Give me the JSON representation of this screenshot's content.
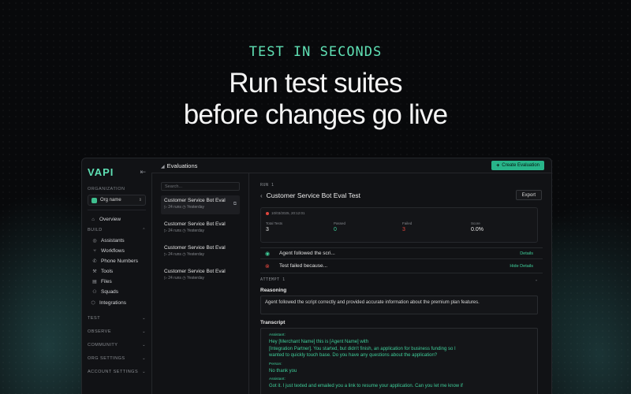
{
  "hero": {
    "eyebrow": "TEST IN SECONDS",
    "headline_line1": "Run test suites",
    "headline_line2": "before changes go live"
  },
  "colors": {
    "accent": "#5fe0b4",
    "button": "#28b58a",
    "danger": "#e0463d",
    "background": "#08090b"
  },
  "sidebar": {
    "logo": "VAPI",
    "org_label": "ORGANIZATION",
    "org_name": "Org name",
    "overview": "Overview",
    "build_label": "BUILD",
    "build_items": [
      {
        "label": "Assistants",
        "icon": "assistant-icon"
      },
      {
        "label": "Workflows",
        "icon": "workflow-icon"
      },
      {
        "label": "Phone Numbers",
        "icon": "phone-icon"
      },
      {
        "label": "Tools",
        "icon": "tool-icon"
      },
      {
        "label": "Files",
        "icon": "file-icon"
      },
      {
        "label": "Squads",
        "icon": "squad-icon"
      }
    ],
    "integrations": "Integrations",
    "groups": [
      "TEST",
      "OBSERVE",
      "COMMUNITY",
      "ORG SETTINGS",
      "ACCOUNT SETTINGS"
    ]
  },
  "topbar": {
    "title": "Evaluations",
    "create_label": "Create Evaluation"
  },
  "list": {
    "search_placeholder": "Search...",
    "items": [
      {
        "name": "Customer Service Bot Eval",
        "runs": "24 runs",
        "when": "Yesterday"
      },
      {
        "name": "Customer Service Bot Eval",
        "runs": "24 runs",
        "when": "Yesterday"
      },
      {
        "name": "Customer Service Bot Eval",
        "runs": "24 runs",
        "when": "Yesterday"
      },
      {
        "name": "Customer Service Bot Eval",
        "runs": "24 runs",
        "when": "Yesterday"
      }
    ]
  },
  "detail": {
    "run_label": "RUN 1",
    "title": "Customer Service Bot Eval Test",
    "export_label": "Export",
    "timestamp": "10/03/2025, 20:12:01",
    "stats": [
      {
        "label": "Total Tests",
        "value": "3"
      },
      {
        "label": "Passed",
        "value": "0"
      },
      {
        "label": "Failed",
        "value": "3"
      },
      {
        "label": "Score",
        "value": "0.0%"
      }
    ],
    "results": [
      {
        "text": "Agent followed the scri...",
        "link": "Details"
      },
      {
        "text": "Test failed because...",
        "link": "Hide Details"
      }
    ],
    "attempt_label": "ATTEMPT 1",
    "reasoning_label": "Reasoning",
    "reasoning_text": "Agent followed the script correctly and provided accurate information about the premium plan features.",
    "transcript_label": "Transcript",
    "transcript": {
      "role1": "Assistant:",
      "msg1_l1": "Hey [Merchant Name] this is [Agent Name] with",
      "msg1_l2": "[Integration Partner]. You started, but didn't finish, an application for business funding so I",
      "msg1_l3": "wanted to quickly touch base. Do you have any questions about the application?",
      "role2": "Person:",
      "msg2": "No thank you",
      "role3": "Assistant:",
      "msg3": "Got it. I just texted and emailed you a link to resume your application. Can you let me know if"
    }
  }
}
